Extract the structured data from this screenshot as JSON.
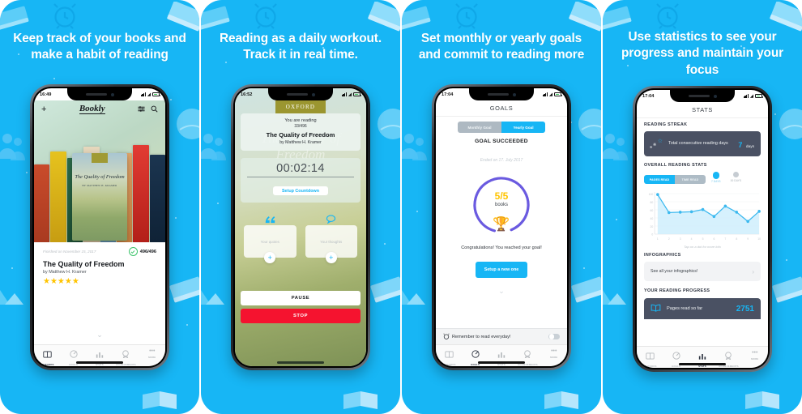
{
  "brand_color": "#17b6f5",
  "panels": [
    {
      "headline": "Keep track of your books and make a habit of reading",
      "status": {
        "time": "16:49"
      },
      "app": {
        "logo": "Bookly",
        "icons": {
          "add": "+",
          "filter": "filter-icon",
          "search": "search-icon"
        },
        "finished": "Finished on November 15, 2017",
        "pages": "496/496",
        "title": "The Quality of Freedom",
        "author": "by Matthew H. Kramer",
        "rating": "★★★★★",
        "cover_title": "The Quality of Freedom",
        "cover_sub": "BY MATTHEW H. KRAMER",
        "cover_band": "OXFORD"
      }
    },
    {
      "headline": "Reading as a daily workout. Track it in real time.",
      "status": {
        "time": "16:52"
      },
      "app": {
        "publisher": "OXFORD",
        "reading_label": "You are reading",
        "pages": "33/496",
        "title": "The Quality of Freedom",
        "author": "by Matthew H. Kramer",
        "timer": "00:02:14",
        "countdown_button": "Setup Countdown",
        "quotes_label": "Your quotes",
        "thoughts_label": "Your thoughts",
        "plus": "+",
        "pause_button": "PAUSE",
        "stop_button": "STOP"
      }
    },
    {
      "headline": "Set monthly or yearly goals and commit to reading more",
      "status": {
        "time": "17:04"
      },
      "app": {
        "screen_title": "GOALS",
        "segment_monthly": "Monthly Goal",
        "segment_yearly": "Yearly Goal",
        "status_text": "GOAL SUCCEEDED",
        "ended": "Ended on 17. July 2017",
        "ring_value": "5/5",
        "ring_unit": "books",
        "congrats": "Congratulations! You reached your goal!",
        "setup_button": "Setup a new one",
        "reminder": "Remember to read everyday!"
      }
    },
    {
      "headline": "Use statistics to see your progress and maintain your focus",
      "status": {
        "time": "17:04"
      },
      "app": {
        "screen_title": "STATS",
        "streak_section": "READING STREAK",
        "streak_text": "Total consecutive reading days",
        "streak_value": "7",
        "streak_unit": "days",
        "overall_section": "OVERALL READING STATS",
        "tab_pages": "PAGES READ",
        "tab_time": "TIME READ",
        "radio_7": "7 DAYS",
        "radio_30": "30 DAYS",
        "chart_hint": "Tap on a dot for more info",
        "infographics_section": "INFOGRAPHICS",
        "infographics_link": "See all your infographics!",
        "progress_section": "YOUR READING PROGRESS",
        "progress_text": "Pages read so far",
        "progress_value": "2751"
      }
    }
  ],
  "tabbar": {
    "items": [
      {
        "label": "MY BOOKS",
        "icon": "book-icon"
      },
      {
        "label": "GOALS",
        "icon": "target-icon"
      },
      {
        "label": "STATS",
        "icon": "bar-chart-icon"
      },
      {
        "label": "ACHIEVEMENTS",
        "icon": "medal-icon"
      },
      {
        "label": "MORE",
        "icon": "ellipsis-icon"
      }
    ]
  },
  "chart_data": {
    "type": "area",
    "title": "OVERALL READING STATS",
    "series_name": "PAGES READ",
    "x": [
      1,
      2,
      3,
      4,
      5,
      6,
      7,
      8,
      9,
      10
    ],
    "values": [
      103,
      56,
      57,
      58,
      64,
      46,
      73,
      57,
      33,
      59
    ],
    "xlabel": "",
    "ylabel": "",
    "ylim": [
      0,
      110
    ],
    "yticks": [
      0,
      20,
      40,
      60,
      80,
      100
    ],
    "xticks": [
      "1",
      "2",
      "3",
      "4",
      "5",
      "6",
      "7",
      "8",
      "9",
      "10"
    ],
    "grid": true,
    "legend": false,
    "annotation": "Tap on a dot for more info",
    "line_color": "#17b6f5",
    "fill_color": "#cfeefd",
    "range_selected": "7 DAYS",
    "metric_selected": "PAGES READ"
  }
}
